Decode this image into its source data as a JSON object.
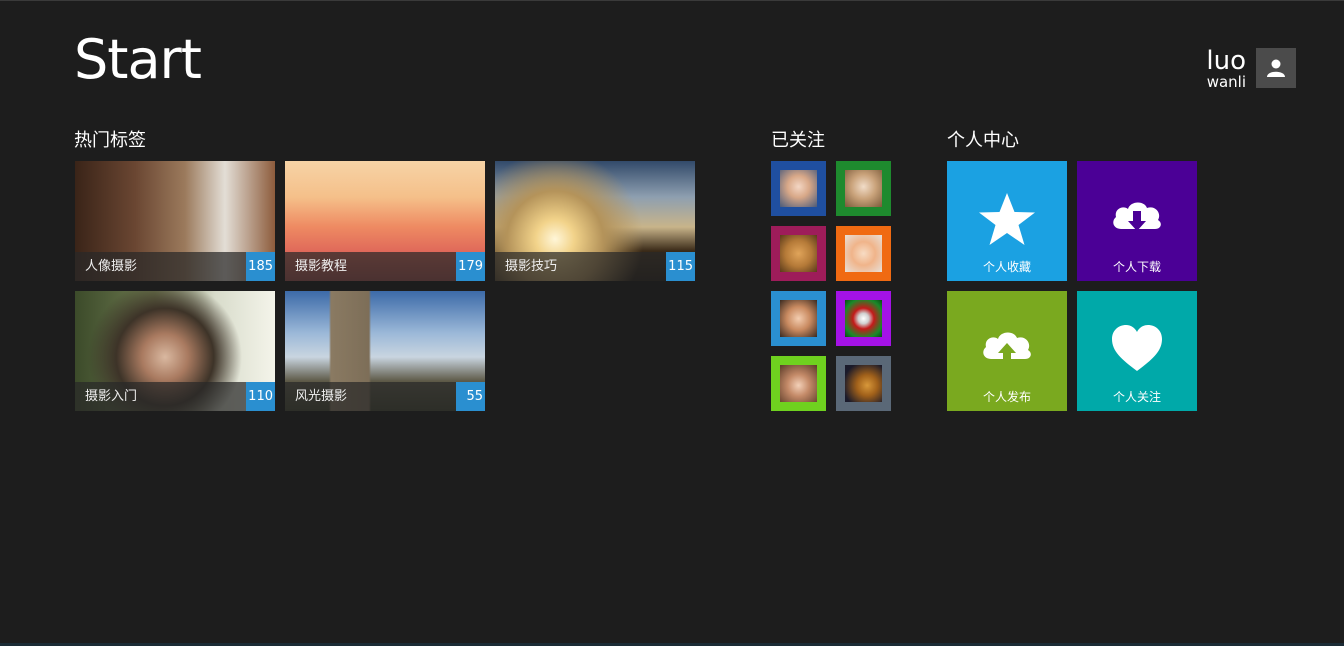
{
  "header": {
    "title": "Start"
  },
  "user": {
    "first": "luo",
    "last": "wanli",
    "icon": "user-icon"
  },
  "hot_tags": {
    "title": "热门标签",
    "items": [
      {
        "label": "人像摄影",
        "count": "185"
      },
      {
        "label": "摄影教程",
        "count": "179"
      },
      {
        "label": "摄影技巧",
        "count": "115"
      },
      {
        "label": "摄影入门",
        "count": "110"
      },
      {
        "label": "风光摄影",
        "count": "55"
      }
    ]
  },
  "followed": {
    "title": "已关注",
    "colors": [
      "#1f4fa0",
      "#1e8a2e",
      "#9e1c5a",
      "#f06a12",
      "#2a8fd0",
      "#a412e6",
      "#6fd11f",
      "#5a6877"
    ]
  },
  "center": {
    "title": "个人中心",
    "tiles": [
      {
        "label": "个人收藏",
        "icon": "star-icon",
        "color": "#1ba1e2"
      },
      {
        "label": "个人下载",
        "icon": "cloud-download-icon",
        "color": "#4b0096"
      },
      {
        "label": "个人发布",
        "icon": "cloud-upload-icon",
        "color": "#7aa91f"
      },
      {
        "label": "个人关注",
        "icon": "heart-icon",
        "color": "#00a9a9"
      }
    ]
  }
}
